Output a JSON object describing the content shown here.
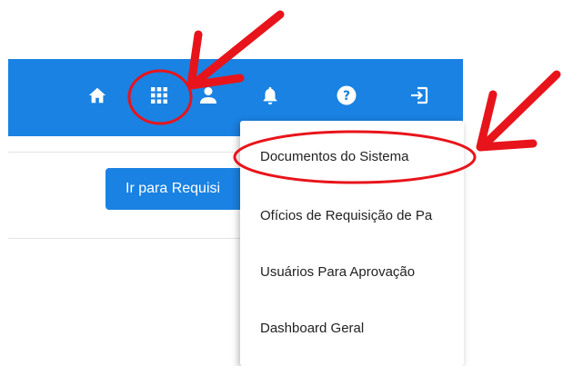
{
  "colors": {
    "navbar": "#1a82e2",
    "button": "#1a82e2",
    "annotation": "#e8141b",
    "icon": "#ffffff",
    "menu_text": "#222222"
  },
  "navbar": {
    "icons": [
      "home-icon",
      "apps-grid-icon",
      "user-icon",
      "bell-icon",
      "help-icon",
      "logout-icon"
    ]
  },
  "main": {
    "button_label": "Ir para Requisi"
  },
  "menu": {
    "items": [
      {
        "label": "Documentos do Sistema"
      },
      {
        "label": "Ofícios de Requisição de Pa"
      },
      {
        "label": "Usuários Para Aprovação"
      },
      {
        "label": "Dashboard Geral"
      }
    ]
  }
}
